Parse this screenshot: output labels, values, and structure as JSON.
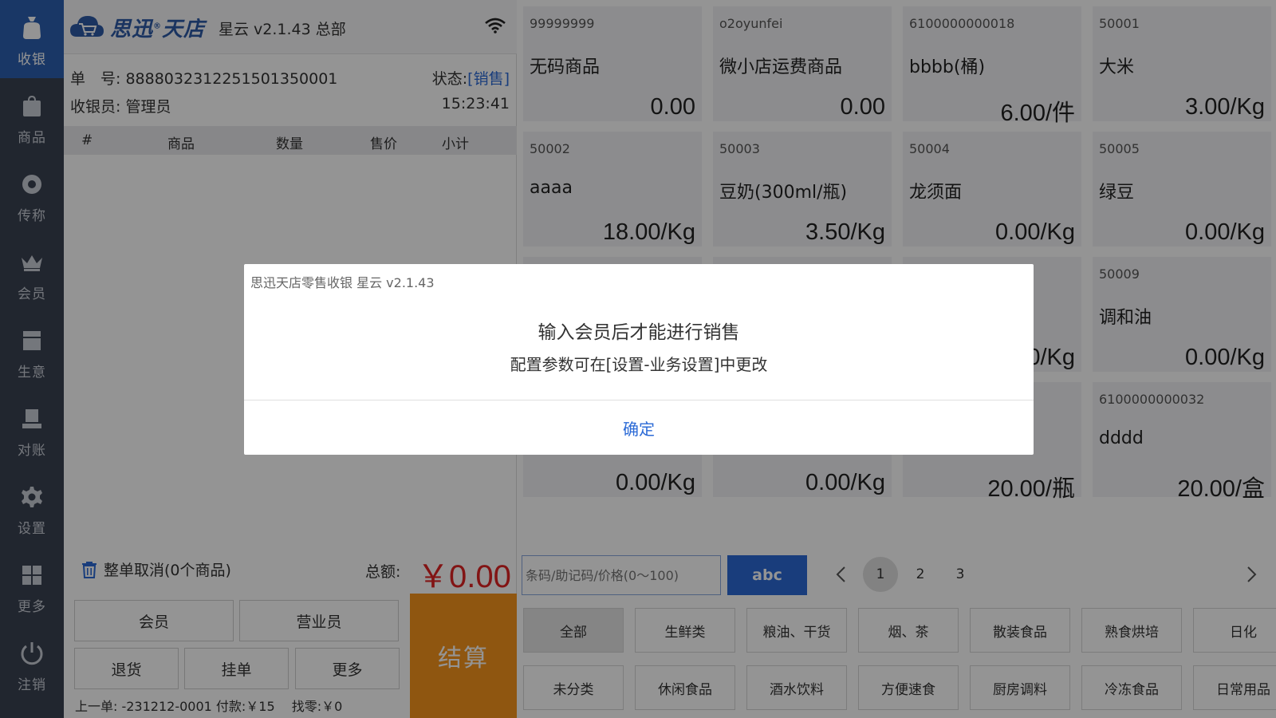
{
  "colors": {
    "nav_bg": "#3a4252",
    "nav_active": "#2b5fb0",
    "accent_blue": "#2b6ad6",
    "total_red": "#e02424",
    "checkout_orange": "#f7941d"
  },
  "sidebar": {
    "items": [
      {
        "label": "收银",
        "icon": "cashier-bag-icon"
      },
      {
        "label": "商品",
        "icon": "shopping-bag-icon"
      },
      {
        "label": "传称",
        "icon": "scale-icon"
      },
      {
        "label": "会员",
        "icon": "crown-icon"
      },
      {
        "label": "生意",
        "icon": "register-icon"
      },
      {
        "label": "对账",
        "icon": "reconcile-icon"
      },
      {
        "label": "设置",
        "icon": "gear-icon"
      },
      {
        "label": "更多",
        "icon": "grid-icon"
      },
      {
        "label": "注销",
        "icon": "power-icon"
      }
    ]
  },
  "header": {
    "logo_text": "思迅",
    "logo_text2": "天店",
    "version": "星云 v2.1.43  总部"
  },
  "order": {
    "number_label": "单　号:",
    "number": "8888032312251501350001",
    "status_label": "状态:",
    "status": "[销售]",
    "cashier_label": "收银员:",
    "cashier": "管理员",
    "time": "15:23:41",
    "columns": [
      "#",
      "商品",
      "数量",
      "售价",
      "小计"
    ],
    "cancel_all": "整单取消(0个商品)",
    "total_label": "总额:",
    "total": "￥0.00",
    "buttons": {
      "member": "会员",
      "salesperson": "营业员",
      "return": "退货",
      "hold": "挂单",
      "more": "更多",
      "checkout": "结算"
    },
    "last_order": "上一单: -231212-0001 付款:￥15",
    "change": "找零:￥0"
  },
  "products": [
    {
      "code": "99999999",
      "name": "无码商品",
      "price": "0.00"
    },
    {
      "code": "o2oyunfei",
      "name": "微小店运费商品",
      "price": "0.00"
    },
    {
      "code": "6100000000018",
      "name": "bbbb(桶)",
      "price": "6.00/件"
    },
    {
      "code": "50001",
      "name": "大米",
      "price": "3.00/Kg"
    },
    {
      "code": "50002",
      "name": "aaaa",
      "price": "18.00/Kg"
    },
    {
      "code": "50003",
      "name": "豆奶(300ml/瓶)",
      "price": "3.50/Kg"
    },
    {
      "code": "50004",
      "name": "龙须面",
      "price": "0.00/Kg"
    },
    {
      "code": "50005",
      "name": "绿豆",
      "price": "0.00/Kg"
    },
    {
      "code": "",
      "name": "",
      "price": ""
    },
    {
      "code": "",
      "name": "",
      "price": ""
    },
    {
      "code": "",
      "name": "",
      "price": "0.00/Kg"
    },
    {
      "code": "50009",
      "name": "调和油",
      "price": "0.00/Kg"
    },
    {
      "code": "",
      "name": "",
      "price": "0.00/Kg"
    },
    {
      "code": "",
      "name": "",
      "price": "0.00/Kg"
    },
    {
      "code": "",
      "name": "",
      "price": "20.00/瓶"
    },
    {
      "code": "6100000000032",
      "name": "dddd",
      "price": "20.00/盒"
    }
  ],
  "search": {
    "placeholder": "条码/助记码/价格(0～100)",
    "abc": "abc"
  },
  "pagination": {
    "pages": [
      "1",
      "2",
      "3"
    ],
    "current": "1"
  },
  "categories": [
    [
      "全部",
      "生鲜类",
      "粮油、干货",
      "烟、茶",
      "散装食品",
      "熟食烘培",
      "日化"
    ],
    [
      "未分类",
      "休闲食品",
      "酒水饮料",
      "方便速食",
      "厨房调料",
      "冷冻食品",
      "日常用品"
    ]
  ],
  "dialog": {
    "title": "思迅天店零售收银 星云 v2.1.43",
    "message": "输入会员后才能进行销售",
    "sub": "配置参数可在[设置-业务设置]中更改",
    "ok": "确定"
  }
}
